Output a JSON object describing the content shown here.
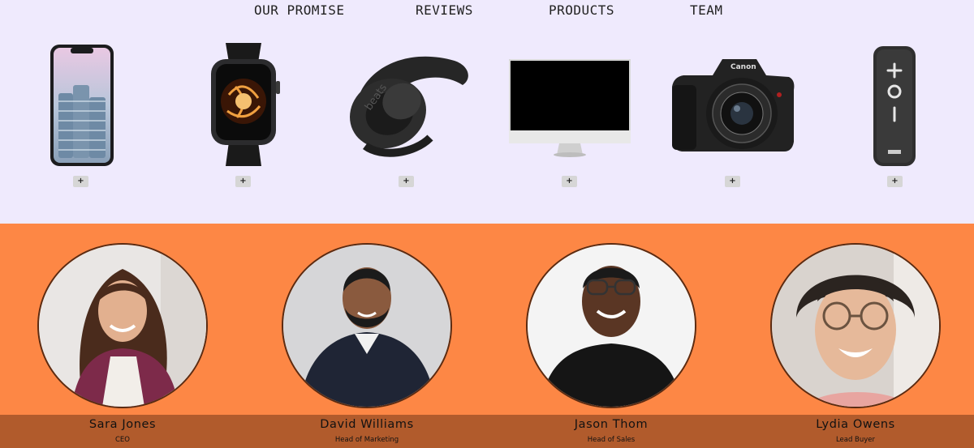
{
  "nav": {
    "items": [
      {
        "label": "OUR PROMISE"
      },
      {
        "label": "REVIEWS"
      },
      {
        "label": "PRODUCTS"
      },
      {
        "label": "TEAM"
      }
    ]
  },
  "products": {
    "add_label": "+",
    "items": [
      {
        "icon": "smartphone-icon"
      },
      {
        "icon": "smartwatch-icon"
      },
      {
        "icon": "headphones-icon"
      },
      {
        "icon": "monitor-icon"
      },
      {
        "icon": "camera-icon"
      },
      {
        "icon": "speaker-icon"
      }
    ]
  },
  "team": {
    "members": [
      {
        "name": "Sara Jones",
        "role": "CEO"
      },
      {
        "name": "David Williams",
        "role": "Head of Marketing"
      },
      {
        "name": "Jason Thom",
        "role": "Head of Sales"
      },
      {
        "name": "Lydia Owens",
        "role": "Lead Buyer"
      }
    ]
  },
  "colors": {
    "top_background": "#efeafd",
    "team_background": "#fd8745",
    "team_strip": "#b15b2c"
  }
}
